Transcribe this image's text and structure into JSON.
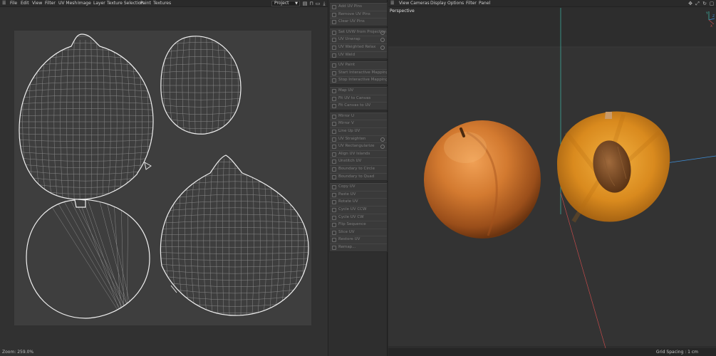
{
  "uv_editor": {
    "menu": [
      "File",
      "Edit",
      "View",
      "Filter",
      "UV Mesh",
      "Image",
      "Layer",
      "Texture Selection",
      "Paint",
      "Textures"
    ],
    "project_select": "Project",
    "status": "Zoom: 259.0%"
  },
  "uv_commands": {
    "groups": [
      [
        "Add UV Pins",
        "Remove UV Pins",
        "Clear UV Pins"
      ],
      [
        "Set UVW from Projection",
        "UV Unwrap",
        "UV Weighted Relax",
        "UV Weld"
      ],
      [
        "UV Paint",
        "Start Interactive Mapping",
        "Stop Interactive Mapping"
      ],
      [
        "Map UV",
        "Fit UV to Canvas",
        "Fit Canvas to UV"
      ],
      [
        "Mirror U",
        "Mirror V",
        "Line Up UV",
        "UV Straighten",
        "UV Rectangularize",
        "Align UV Islands",
        "Unstitch UV",
        "Boundary to Circle",
        "Boundary to Quad"
      ],
      [
        "Copy UV",
        "Paste UV",
        "Rotate UV",
        "Cycle UV CCW",
        "Cycle UV CW",
        "Flip Sequence",
        "Slice UV",
        "Restore UV",
        "Remap..."
      ]
    ],
    "gear_items": [
      "Set UVW from Projection",
      "UV Unwrap",
      "UV Weighted Relax",
      "UV Straighten",
      "UV Rectangularize"
    ]
  },
  "viewport": {
    "menu": [
      "View",
      "Cameras",
      "Display",
      "Options",
      "Filter",
      "Panel"
    ],
    "label": "Perspective",
    "status": "Grid Spacing : 1 cm",
    "axis": {
      "y": "Y",
      "z": "Z",
      "x": "X"
    },
    "colors": {
      "axis_y": "#3fb8a8",
      "axis_x": "#c24a4a",
      "axis_z": "#3f8ed8"
    }
  }
}
